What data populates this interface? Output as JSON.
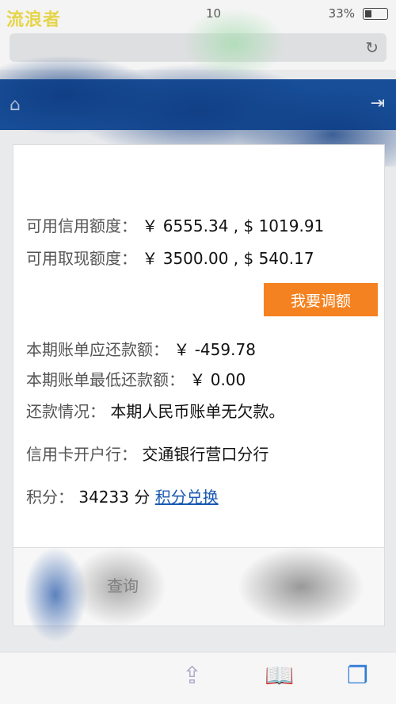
{
  "status_bar": {
    "carrier": "流浪者",
    "time": "10",
    "battery": "33%"
  },
  "info": {
    "credit_label": "可用信用额度：",
    "credit_value": "￥ 6555.34 , $ 1019.91",
    "cash_label": "可用取现额度：",
    "cash_value": "￥ 3500.00 , $ 540.17",
    "adjust_button": "我要调额",
    "due_label": "本期账单应还款额：",
    "due_value": "￥ -459.78",
    "min_label": "本期账单最低还款额：",
    "min_value": "￥ 0.00",
    "repay_label": "还款情况：",
    "repay_value": "本期人民币账单无欠款。",
    "bank_label": "信用卡开户行：",
    "bank_value": "交通银行营口分行",
    "points_label": "积分：",
    "points_value": "34233 分",
    "points_link": "积分兑换"
  },
  "bottom": {
    "query_label": "查询"
  },
  "colors": {
    "header_blue": "#174e97",
    "accent_orange": "#f58220",
    "link_blue": "#1a5ab3"
  },
  "icons": [
    "home-icon",
    "logout-icon",
    "reload-icon",
    "share-icon",
    "bookmarks-icon",
    "tabs-icon"
  ]
}
